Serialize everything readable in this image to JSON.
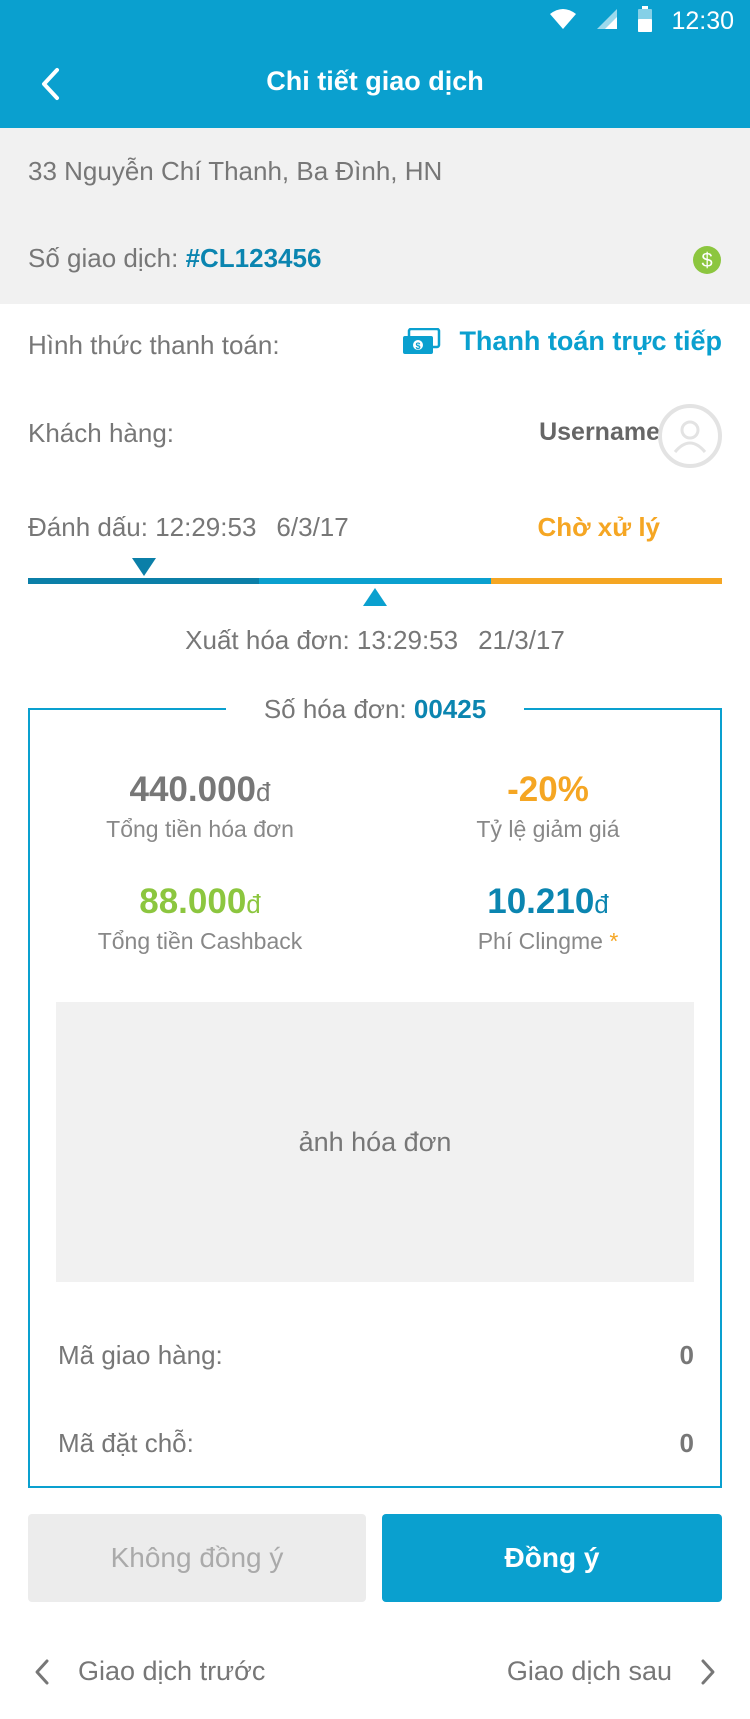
{
  "status_bar": {
    "time": "12:30"
  },
  "header": {
    "title": "Chi tiết giao dịch"
  },
  "transaction": {
    "address": "33 Nguyễn Chí Thanh, Ba Đình, HN",
    "txn_label": "Số giao dịch:",
    "txn_id": "#CL123456",
    "payment_label": "Hình thức thanh toán:",
    "payment_value": "Thanh toán trực tiếp",
    "customer_label": "Khách hàng:",
    "customer_name": "Username",
    "mark_label": "Đánh dấu: 12:29:53",
    "mark_date": "6/3/17",
    "status": "Chờ xử lý",
    "invoice_time_label": "Xuất hóa đơn: 13:29:53",
    "invoice_date": "21/3/17"
  },
  "invoice": {
    "number_label": "Số hóa đơn:",
    "number": "00425",
    "total": "440.000",
    "total_unit": "đ",
    "total_label": "Tổng tiền hóa đơn",
    "discount": "-20%",
    "discount_label": "Tỷ lệ giảm giá",
    "cashback": "88.000",
    "cashback_unit": "đ",
    "cashback_label": "Tổng tiền Cashback",
    "fee": "10.210",
    "fee_unit": "đ",
    "fee_label": "Phí Clingme",
    "fee_asterisk": "*",
    "photo_placeholder": "ảnh hóa đơn",
    "delivery_code_label": "Mã giao hàng:",
    "delivery_code": "0",
    "booking_code_label": "Mã đặt chỗ:",
    "booking_code": "0"
  },
  "actions": {
    "reject_label": "Không đồng ý",
    "accept_label": "Đồng ý"
  },
  "pager": {
    "prev_label": "Giao dịch trước",
    "next_label": "Giao dịch sau"
  },
  "colors": {
    "primary": "#0aa0cf",
    "dark_blue": "#0b7fa8",
    "orange": "#f5a623",
    "green": "#8cc63f"
  }
}
